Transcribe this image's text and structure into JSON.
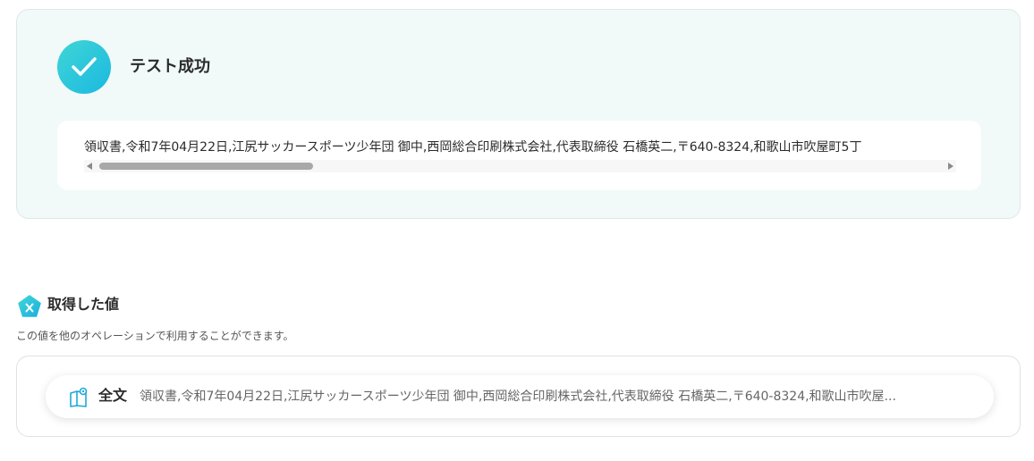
{
  "test_result": {
    "title": "テスト成功",
    "output_text": "領収書,令和7年04月22日,江尻サッカースポーツ少年団 御中,西岡総合印刷株式会社,代表取締役 石橋英二,〒640-8324,和歌山市吹屋町5丁"
  },
  "acquired_values": {
    "title": "取得した値",
    "description": "この値を他のオペレーションで利用することができます。",
    "items": [
      {
        "label": "全文",
        "value": "領収書,令和7年04月22日,江尻サッカースポーツ少年団 御中,西岡総合印刷株式会社,代表取締役 石橋英二,〒640-8324,和歌山市吹屋..."
      }
    ]
  },
  "icons": {
    "success": "check-circle-icon",
    "section": "variable-pentagon-icon",
    "item": "document-icon"
  },
  "colors": {
    "accent": "#1fc2dd",
    "success_panel_bg": "#f1f9f9"
  }
}
